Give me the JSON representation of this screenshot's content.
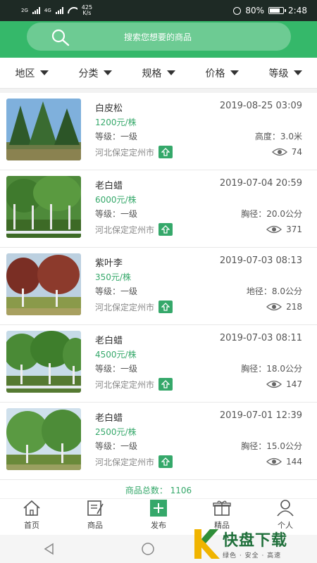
{
  "status_bar": {
    "signal1": "2G",
    "signal2": "4G",
    "speed_value": "425",
    "speed_unit": "K/s",
    "battery": "80%",
    "time": "2:48"
  },
  "search": {
    "placeholder": "搜索您想要的商品"
  },
  "filters": [
    "地区",
    "分类",
    "规格",
    "价格",
    "等级"
  ],
  "items": [
    {
      "name": "白皮松",
      "date": "2019-08-25 03:09",
      "price": "1200元/株",
      "grade": "等级：一级",
      "spec": "高度：3.0米",
      "location": "河北保定定州市",
      "views": "74"
    },
    {
      "name": "老白蜡",
      "date": "2019-07-04 20:59",
      "price": "6000元/株",
      "grade": "等级：一级",
      "spec": "胸径：20.0公分",
      "location": "河北保定定州市",
      "views": "371"
    },
    {
      "name": "紫叶李",
      "date": "2019-07-03 08:13",
      "price": "350元/株",
      "grade": "等级：一级",
      "spec": "地径：8.0公分",
      "location": "河北保定定州市",
      "views": "218"
    },
    {
      "name": "老白蜡",
      "date": "2019-07-03 08:11",
      "price": "4500元/株",
      "grade": "等级：一级",
      "spec": "胸径：18.0公分",
      "location": "河北保定定州市",
      "views": "147"
    },
    {
      "name": "老白蜡",
      "date": "2019-07-01 12:39",
      "price": "2500元/株",
      "grade": "等级：一级",
      "spec": "胸径：15.0公分",
      "location": "河北保定定州市",
      "views": "144"
    }
  ],
  "total": "商品总数：  1106",
  "tabs": [
    {
      "label": "首页",
      "icon": "home-icon"
    },
    {
      "label": "商品",
      "icon": "goods-icon"
    },
    {
      "label": "发布",
      "icon": "publish-icon"
    },
    {
      "label": "精品",
      "icon": "gift-icon"
    },
    {
      "label": "个人",
      "icon": "user-icon"
    }
  ],
  "watermark": {
    "brand": "快盘下载",
    "slogan": "绿色 · 安全 · 高速"
  },
  "colors": {
    "accent": "#35b86a",
    "price": "#35a86a",
    "status_bar": "#1e2a25"
  }
}
